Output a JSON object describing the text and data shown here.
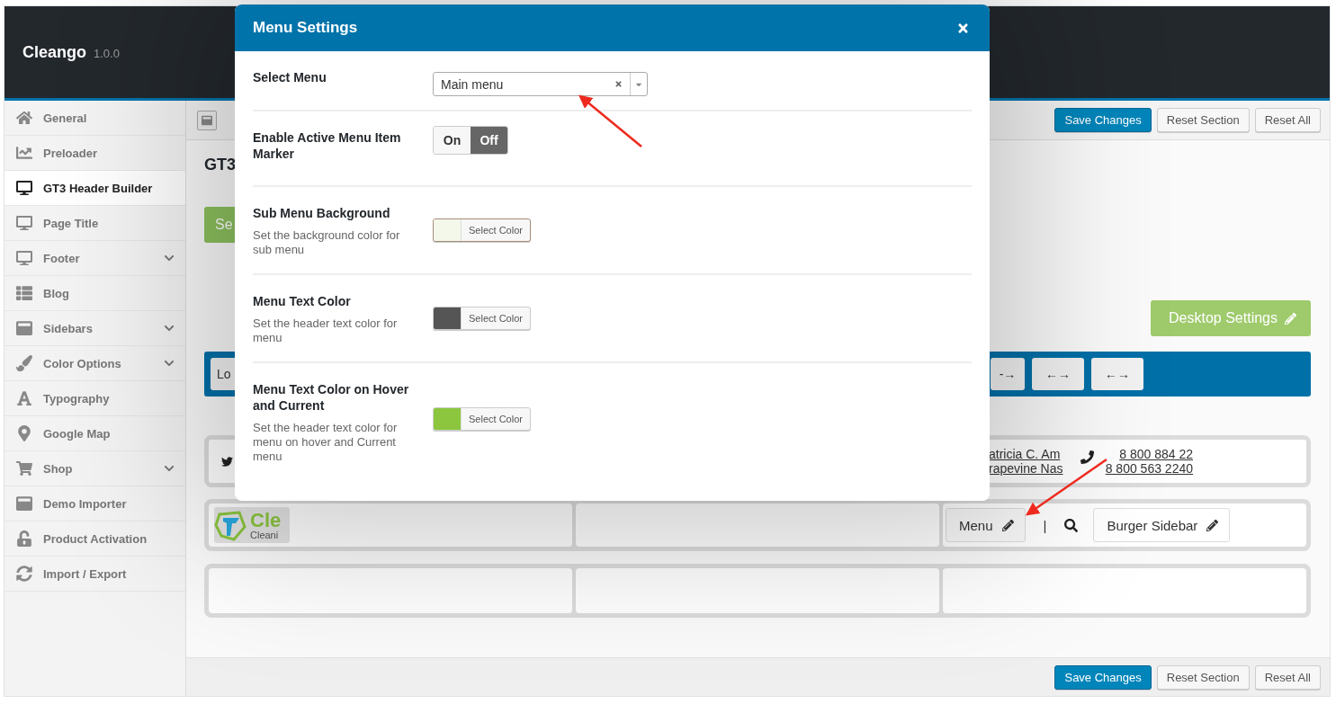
{
  "header": {
    "title": "Cleango",
    "version": "1.0.0"
  },
  "sidebar": {
    "items": [
      {
        "label": "General",
        "selected": false,
        "expandable": false
      },
      {
        "label": "Preloader",
        "selected": false,
        "expandable": false
      },
      {
        "label": "GT3 Header Builder",
        "selected": true,
        "expandable": false
      },
      {
        "label": "Page Title",
        "selected": false,
        "expandable": false
      },
      {
        "label": "Footer",
        "selected": false,
        "expandable": true
      },
      {
        "label": "Blog",
        "selected": false,
        "expandable": false
      },
      {
        "label": "Sidebars",
        "selected": false,
        "expandable": true
      },
      {
        "label": "Color Options",
        "selected": false,
        "expandable": true
      },
      {
        "label": "Typography",
        "selected": false,
        "expandable": false
      },
      {
        "label": "Google Map",
        "selected": false,
        "expandable": false
      },
      {
        "label": "Shop",
        "selected": false,
        "expandable": true
      },
      {
        "label": "Demo Importer",
        "selected": false,
        "expandable": false
      },
      {
        "label": "Product Activation",
        "selected": false,
        "expandable": false
      },
      {
        "label": "Import / Export",
        "selected": false,
        "expandable": false
      }
    ]
  },
  "toolbar": {
    "buttons": [
      {
        "label": "Save Changes",
        "kind": "primary"
      },
      {
        "label": "Reset Section",
        "kind": "default"
      },
      {
        "label": "Reset All",
        "kind": "default"
      }
    ]
  },
  "content": {
    "heading": "GT3",
    "green_button": "Se",
    "desktop_settings": "Desktop Settings",
    "bar": {
      "first_button": "Lo",
      "arrow_buttons": [
        "-→",
        "←→",
        "←→"
      ]
    },
    "top_row": {
      "address_lines": [
        "atricia C. Am",
        "rapevine Nas"
      ],
      "phones": [
        "8 800 884 22",
        "8 800 563 2240"
      ]
    },
    "middle_row": {
      "logo": {
        "title": "Cle",
        "subtitle": "Cleani"
      },
      "menu_button": "Menu",
      "separator": "|",
      "burger_button": "Burger Sidebar"
    }
  },
  "footer": {
    "buttons": [
      {
        "label": "Save Changes",
        "kind": "primary"
      },
      {
        "label": "Reset Section",
        "kind": "default"
      },
      {
        "label": "Reset All",
        "kind": "default"
      }
    ]
  },
  "modal": {
    "title": "Menu Settings",
    "rows": [
      {
        "kind": "select",
        "label": "Select Menu",
        "value": "Main menu"
      },
      {
        "kind": "toggle",
        "label": "Enable Active Menu Item Marker",
        "options": [
          {
            "label": "On",
            "selected": false
          },
          {
            "label": "Off",
            "selected": true
          }
        ]
      },
      {
        "kind": "color",
        "label": "Sub Menu Background",
        "description": "Set the background color for sub menu",
        "color": "#f3f8ea",
        "button": "Select Color",
        "focused": true
      },
      {
        "kind": "color",
        "label": "Menu Text Color",
        "description": "Set the header text color for menu",
        "color": "#555555",
        "button": "Select Color",
        "focused": false
      },
      {
        "kind": "color",
        "label": "Menu Text Color on Hover and Current",
        "description": "Set the header text color for menu on hover and Current menu",
        "color": "#8cc63f",
        "button": "Select Color",
        "focused": false
      }
    ]
  }
}
